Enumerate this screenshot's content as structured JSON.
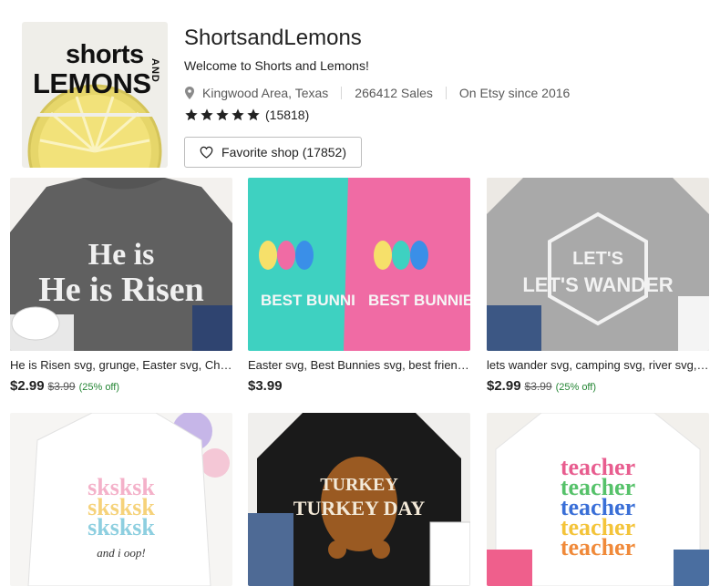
{
  "shop": {
    "logo": {
      "line1": "shorts",
      "line2": "LEMONS",
      "and": "AND"
    },
    "name": "ShortsandLemons",
    "tagline": "Welcome to Shorts and Lemons!",
    "location": "Kingwood Area, Texas",
    "sales": "266412 Sales",
    "since": "On Etsy since 2016",
    "rating_stars": 5,
    "rating_count": "(15818)",
    "favorite_label": "Favorite shop (17852)"
  },
  "colors": {
    "star": "#222222",
    "discount_green": "#258635",
    "lemon_yellow": "#f2e27a"
  },
  "listings": [
    {
      "title": "He is Risen svg, grunge, Easter svg, Christian svg",
      "image_text": "He is Risen",
      "price": "$2.99",
      "original_price": "$3.99",
      "discount": "(25% off)"
    },
    {
      "title": "Easter svg, Best Bunnies svg, best friends svg",
      "image_text": "BEST BUNNIES",
      "price": "$3.99",
      "original_price": "",
      "discount": ""
    },
    {
      "title": "lets wander svg, camping svg, river svg, mountains",
      "image_text": "LET'S WANDER",
      "price": "$2.99",
      "original_price": "$3.99",
      "discount": "(25% off)"
    },
    {
      "image_text": "sksksk",
      "image_subtext": "and i oop!"
    },
    {
      "image_text": "TURKEY DAY"
    },
    {
      "image_text": "teacher"
    }
  ]
}
